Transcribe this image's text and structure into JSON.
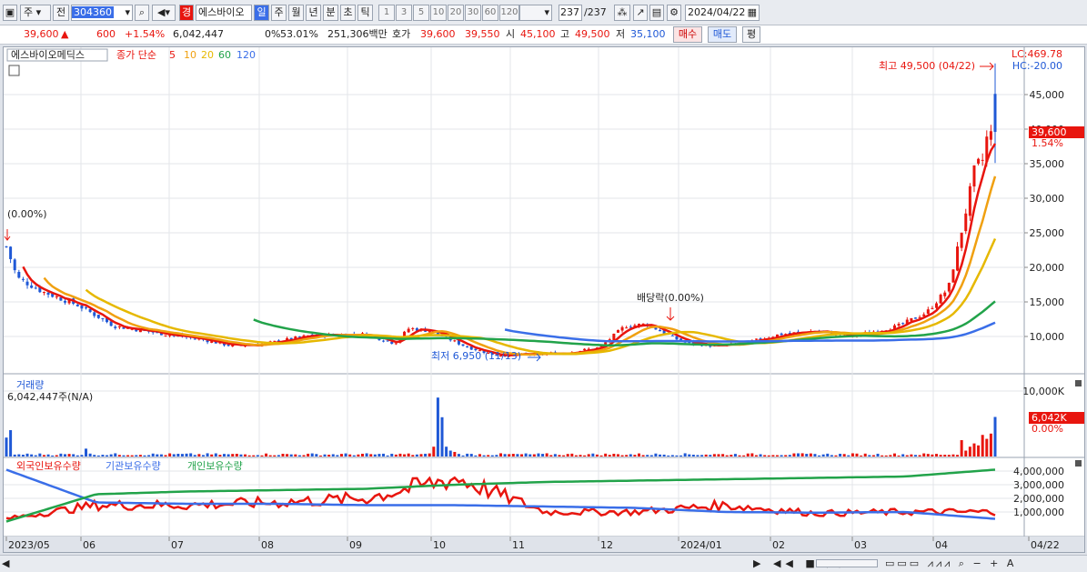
{
  "toolbar": {
    "market": "주",
    "prev_label": "전",
    "code": "304360",
    "stock_name": "에스바이오",
    "badge": "경",
    "period_tabs": [
      "일",
      "주",
      "월",
      "년",
      "분",
      "초",
      "틱"
    ],
    "minute_options": [
      "1",
      "3",
      "5",
      "10",
      "20",
      "30",
      "60",
      "120"
    ],
    "count": "237",
    "total": "/237",
    "date": "2024/04/22"
  },
  "quote": {
    "price": "39,600",
    "arrow": "▲",
    "change": "600",
    "change_pct": "+1.54%",
    "volume": "6,042,447",
    "pct1": "0%",
    "pct2": "53.01%",
    "amount": "251,306백만",
    "hoga_label": "호가",
    "hoga_ask": "39,600",
    "hoga_bid": "39,550",
    "open_label": "시",
    "open": "45,100",
    "high_label": "고",
    "high": "49,500",
    "low_label": "저",
    "low": "35,100",
    "buy": "매수",
    "sell": "매도",
    "avg": "평"
  },
  "price_pane": {
    "name": "에스바이오메딕스",
    "ma_label": "종가 단순",
    "ma_periods": [
      "5",
      "10",
      "20",
      "60",
      "120"
    ],
    "lc": "LC:469.78",
    "hc": "HC:-20.00",
    "high_note": "최고 49,500 (04/22)",
    "low_note": "최저 6,950 (11/13)",
    "div_note": "배당락(0.00%)",
    "left_note": "(0.00%)",
    "price_tag": "39,600",
    "pct_tag": "1.54%",
    "y_ticks": [
      "45,000",
      "40,000",
      "35,000",
      "30,000",
      "25,000",
      "20,000",
      "15,000",
      "10,000"
    ]
  },
  "volume_pane": {
    "name": "거래량",
    "value": "6,042,447주(N/A)",
    "y_ticks": [
      "10,000K"
    ],
    "tag": "6,042K",
    "tag_pct": "0.00%"
  },
  "holding_pane": {
    "series": [
      "외국인보유수량",
      "기관보유수량",
      "개인보유수량"
    ],
    "y_ticks": [
      "4,000,000",
      "3,000,000",
      "2,000,000",
      "1,000,000"
    ]
  },
  "x_axis": {
    "labels": [
      "2023/05",
      "06",
      "07",
      "08",
      "09",
      "10",
      "11",
      "12",
      "2024/01",
      "02",
      "03",
      "04",
      "04/22"
    ]
  },
  "colors": {
    "up": "#e8150e",
    "down": "#1f58d6",
    "ma5": "#e8150e",
    "ma10": "#f0a010",
    "ma20": "#e6b800",
    "ma60": "#22a34a",
    "ma120": "#3a6ee8",
    "bg": "#ffffff"
  },
  "chart_data": {
    "type": "candlestick",
    "x": [
      "2023/05",
      "06",
      "07",
      "08",
      "09",
      "10",
      "11",
      "12",
      "2024/01",
      "02",
      "03",
      "04"
    ],
    "close_approx": [
      17000,
      14500,
      10500,
      8800,
      10300,
      10700,
      7300,
      8200,
      10800,
      9000,
      10500,
      39600
    ],
    "volume_approx_k": [
      2500,
      600,
      400,
      300,
      400,
      9000,
      700,
      400,
      300,
      300,
      500,
      6042
    ],
    "foreign": [
      500000,
      1500000,
      1500000,
      1700000,
      2000000,
      3500000,
      1000000,
      1000000,
      1500000,
      900000,
      1000000,
      1000000
    ],
    "institution": [
      4100000,
      1700000,
      1600000,
      1600000,
      1500000,
      1500000,
      1400000,
      1300000,
      1000000,
      950000,
      1000000,
      500000
    ],
    "individual": [
      300000,
      2300000,
      2500000,
      2600000,
      2700000,
      3000000,
      3200000,
      3300000,
      3400000,
      3500000,
      3600000,
      4100000
    ]
  }
}
